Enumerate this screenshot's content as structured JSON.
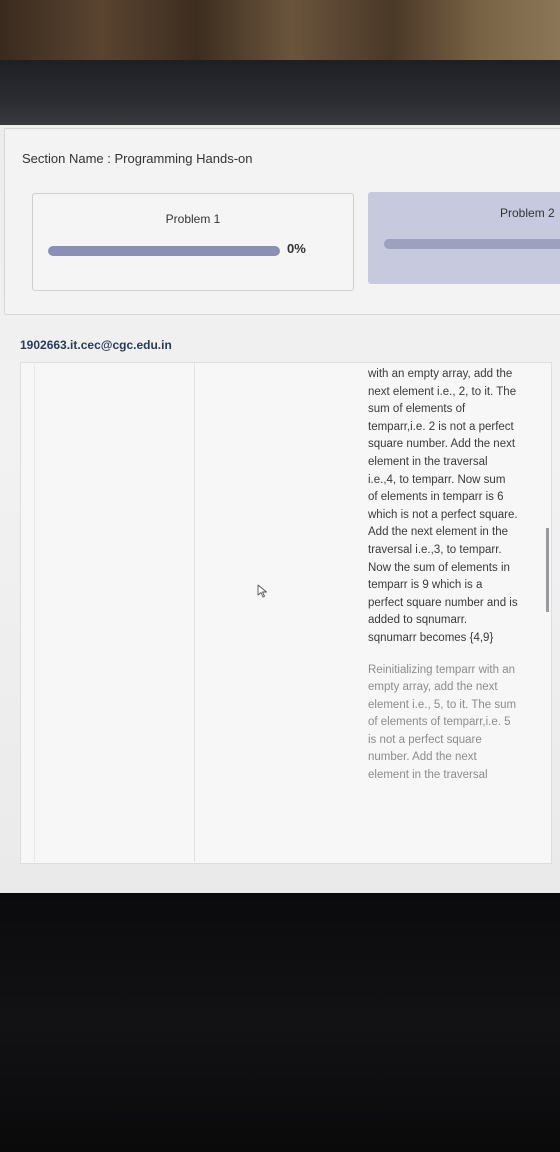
{
  "section": {
    "title": "Section Name : Programming Hands-on"
  },
  "problems": [
    {
      "label": "Problem 1",
      "progress_percent": 0,
      "progress_text": "0%"
    },
    {
      "label": "Problem 2"
    }
  ],
  "user": {
    "email": "1902663.it.cec@cgc.edu.in"
  },
  "content": {
    "paragraphs": [
      "with an empty array, add the next element i.e., 2, to it. The sum of elements of temparr,i.e. 2 is not a perfect square number. Add the next element in the traversal i.e.,4, to temparr. Now sum of elements in temparr is 6 which is not a perfect square. Add the next element in the traversal i.e.,3, to temparr. Now the sum of elements in temparr is 9 which is a perfect square number and is added to sqnumarr. sqnumarr becomes {4,9}",
      "Reinitializing temparr with an empty array, add the next element i.e., 5, to it. The sum of elements of temparr,i.e. 5 is not a perfect square number. Add the next element in the traversal"
    ]
  },
  "icons": {
    "cursor": "mouse-pointer-icon"
  }
}
